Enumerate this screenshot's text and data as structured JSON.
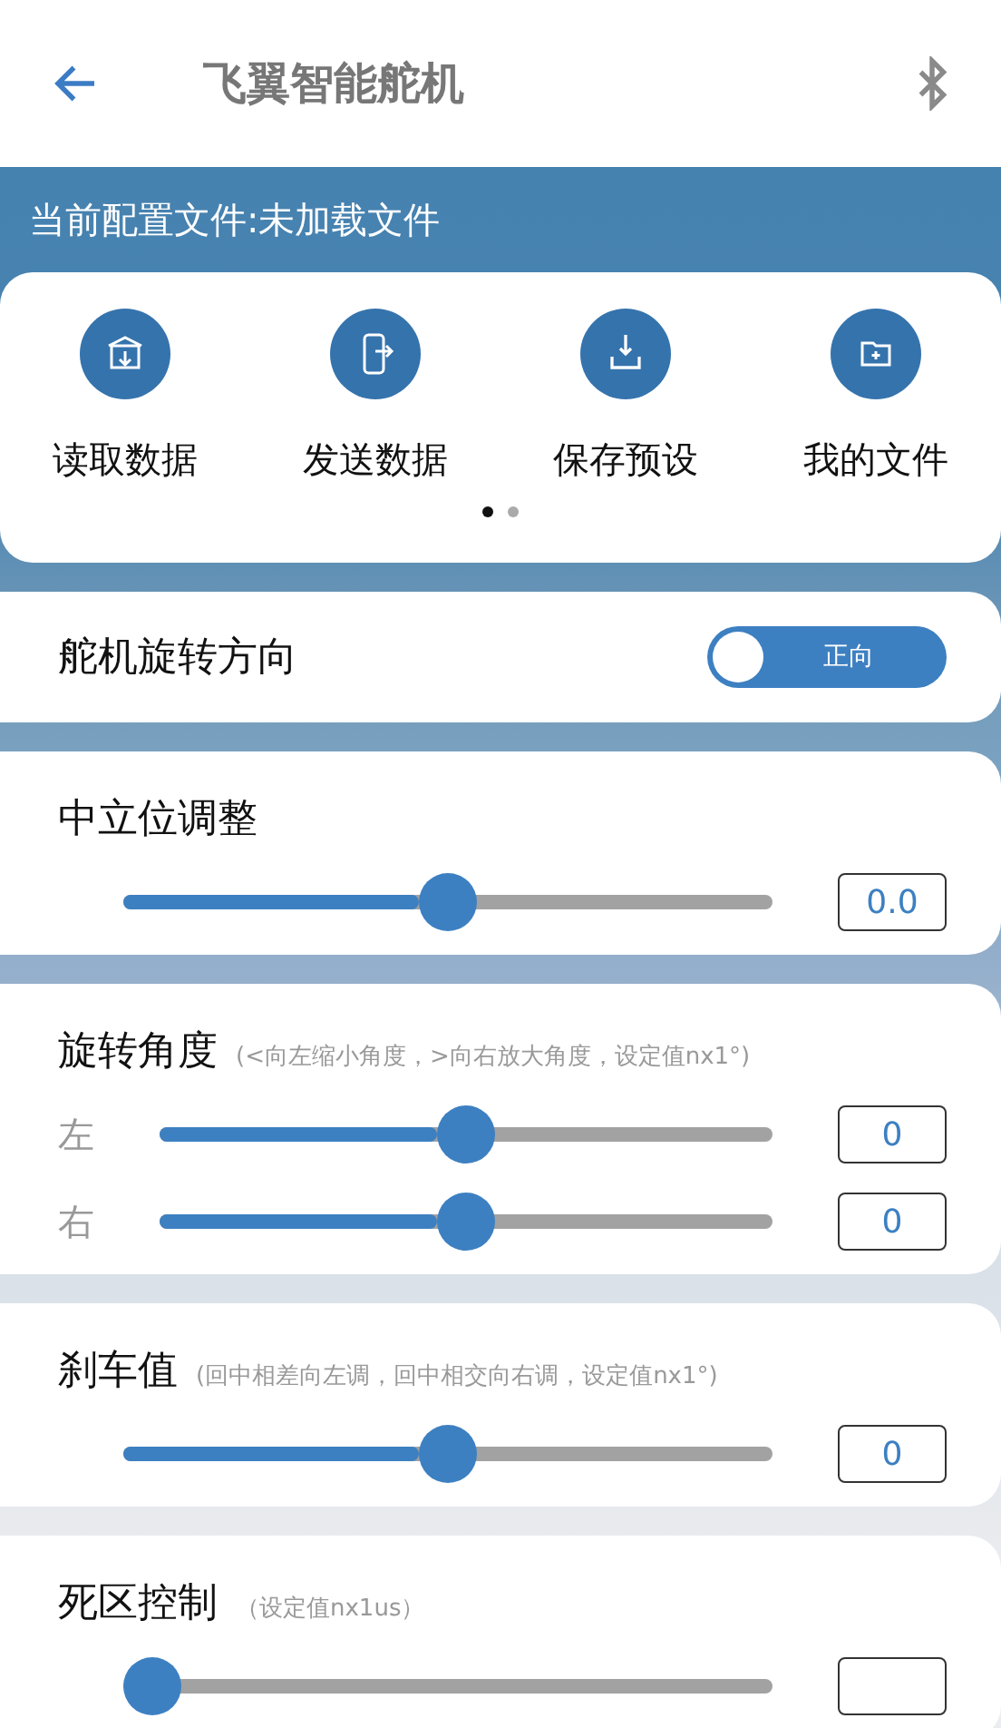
{
  "app_bar": {
    "title": "飞翼智能舵机"
  },
  "config_banner": {
    "text": "当前配置文件:未加载文件"
  },
  "actions": [
    {
      "kind": "read",
      "label": "读取数据"
    },
    {
      "kind": "send",
      "label": "发送数据"
    },
    {
      "kind": "save",
      "label": "保存预设"
    },
    {
      "kind": "folder",
      "label": "我的文件"
    }
  ],
  "pager": [
    {
      "selected": true
    },
    {
      "selected": false
    }
  ],
  "sections": [
    {
      "kind": "switch",
      "title": "舵机旋转方向",
      "switch": {
        "on": true,
        "text": "正向"
      }
    },
    {
      "kind": "sliders",
      "title": "中立位调整",
      "sliders": [
        {
          "level": 0.5,
          "value": "0.0"
        }
      ]
    },
    {
      "kind": "sliders",
      "title": "旋转角度",
      "hint": "(<向左缩小角度，>向右放大角度，设定值nx1°)",
      "sliders": [
        {
          "label": "左",
          "level": 0.5,
          "value": "0"
        },
        {
          "label": "右",
          "level": 0.5,
          "value": "0"
        }
      ]
    },
    {
      "kind": "sliders",
      "title": "刹车值",
      "hint": "(回中相差向左调，回中相交向右调，设定值nx1°)",
      "sliders": [
        {
          "level": 0.5,
          "value": "0"
        }
      ]
    },
    {
      "kind": "sliders",
      "title": "死区控制",
      "hint": "（设定值nx1us）",
      "sliders": [
        {
          "level": 0
        }
      ]
    }
  ]
}
